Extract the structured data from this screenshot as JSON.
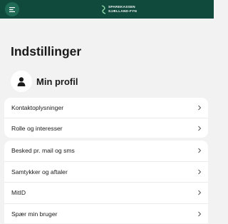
{
  "header": {
    "menu_icon": "hamburger-icon",
    "logo_icon": "sparekassen-logo",
    "logo_line1": "SPAREKASSEN",
    "logo_line2": "SJÆLLAND-FYN",
    "brand_color": "#0f4a3c"
  },
  "page": {
    "title": "Indstillinger"
  },
  "profile": {
    "icon": "user-icon",
    "label": "Min profil"
  },
  "settings_groups": [
    {
      "items": [
        {
          "label": "Kontaktoplysninger",
          "icon": "chevron-right-icon"
        },
        {
          "label": "Rolle og interesser",
          "icon": "chevron-right-icon"
        }
      ]
    },
    {
      "items": [
        {
          "label": "Besked pr. mail og sms",
          "icon": "chevron-right-icon"
        },
        {
          "label": "Samtykker og aftaler",
          "icon": "chevron-right-icon"
        },
        {
          "label": "MitID",
          "icon": "chevron-right-icon"
        },
        {
          "label": "Spær min bruger",
          "icon": "chevron-right-icon"
        }
      ]
    }
  ]
}
